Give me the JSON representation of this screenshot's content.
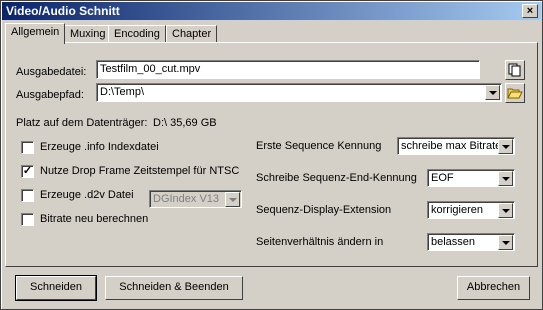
{
  "window": {
    "title": "Video/Audio Schnitt",
    "close_glyph": "×"
  },
  "tabs": [
    {
      "label": "Allgemein",
      "active": true
    },
    {
      "label": "Muxing",
      "active": false
    },
    {
      "label": "Encoding",
      "active": false
    },
    {
      "label": "Chapter",
      "active": false
    }
  ],
  "general": {
    "output_file_label": "Ausgabedatei:",
    "output_file_value": "Testfilm_00_cut.mpv",
    "output_path_label": "Ausgabepfad:",
    "output_path_value": "D:\\Temp\\",
    "disk_space_label": "Platz auf dem Datenträger:",
    "disk_space_value": "D:\\ 35,69 GB",
    "copy_icon": "copy-file-icon",
    "folder_icon": "folder-open-icon"
  },
  "checkboxes": [
    {
      "label": "Erzeuge .info Indexdatei",
      "checked": false,
      "mark": ""
    },
    {
      "label": "Nutze Drop Frame Zeitstempel für NTSC",
      "checked": true,
      "mark": "✓"
    },
    {
      "label": "Erzeuge .d2v Datei",
      "checked": false,
      "mark": ""
    },
    {
      "label": "Bitrate neu berechnen",
      "checked": false,
      "mark": ""
    }
  ],
  "d2v_select": {
    "value": "DGIndex V13",
    "disabled": true
  },
  "options": [
    {
      "label": "Erste Sequence Kennung",
      "value": "schreibe max Bitrate"
    },
    {
      "label": "Schreibe Sequenz-End-Kennung",
      "value": "EOF"
    },
    {
      "label": "Sequenz-Display-Extension",
      "value": "korrigieren"
    },
    {
      "label": "Seitenverhältnis ändern in",
      "value": "belassen"
    }
  ],
  "buttons": {
    "cut": "Schneiden",
    "cut_and_exit": "Schneiden & Beenden",
    "cancel": "Abbrechen"
  }
}
